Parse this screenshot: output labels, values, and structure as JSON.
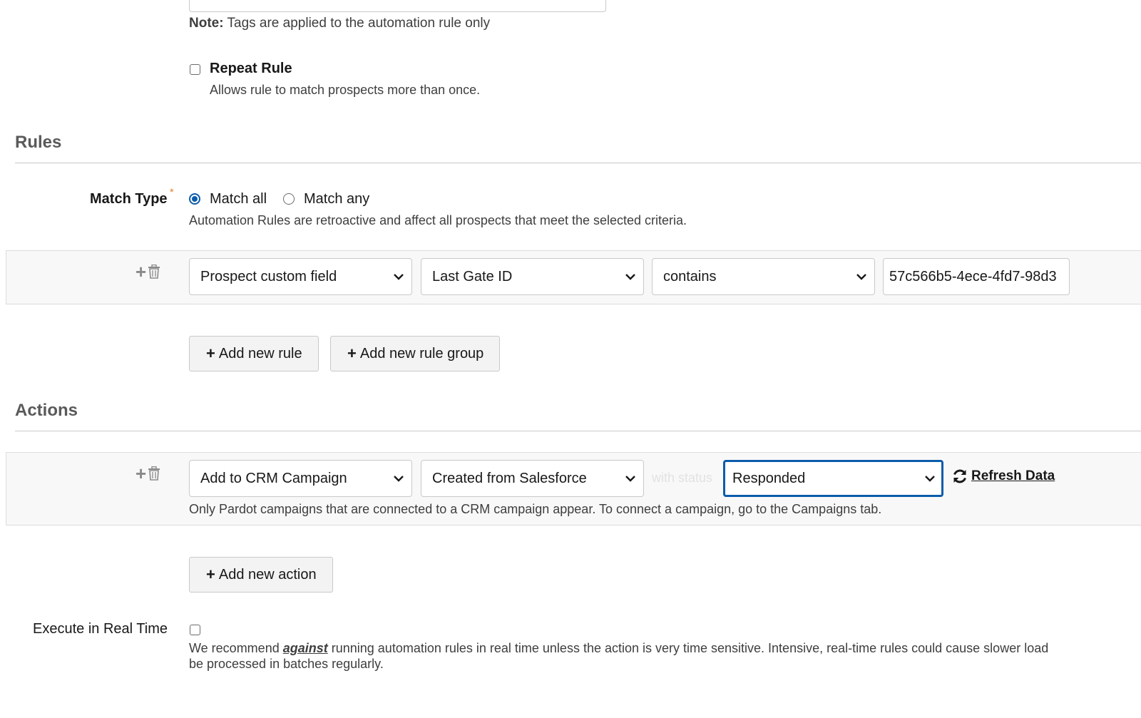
{
  "tags": {
    "note_label": "Note:",
    "note_text": " Tags are applied to the automation rule only"
  },
  "repeat_rule": {
    "label": "Repeat Rule",
    "help": "Allows rule to match prospects more than once.",
    "checked": false
  },
  "rules": {
    "section_title": "Rules",
    "match_type_label": "Match Type",
    "required_mark": "*",
    "match_all_label": "Match all",
    "match_any_label": "Match any",
    "selected_match": "all",
    "help": "Automation Rules are retroactive and affect all prospects that meet the selected criteria.",
    "rule_row": {
      "field_type": "Prospect custom field",
      "field": "Last Gate ID",
      "operator": "contains",
      "value": "57c566b5-4ece-4fd7-98d3"
    },
    "add_rule_label": "Add new rule",
    "add_rule_group_label": "Add new rule group"
  },
  "actions": {
    "section_title": "Actions",
    "action_row": {
      "action_type": "Add to CRM Campaign",
      "campaign": "Created from Salesforce",
      "status_prefix": "with status",
      "status": "Responded",
      "refresh_label": " Refresh Data",
      "help": "Only Pardot campaigns that are connected to a CRM campaign appear. To connect a campaign, go to the Campaigns tab."
    },
    "add_action_label": "Add new action"
  },
  "execute_real_time": {
    "label": "Execute in Real Time",
    "checked": false,
    "help_before": "We recommend ",
    "help_emphasis": "against",
    "help_after": " running automation rules in real time unless the action is very time sensitive. Intensive, real-time rules could cause slower load",
    "help_line2": "be processed in batches regularly."
  },
  "colors": {
    "accent": "#0b5cab",
    "required": "#e07a1f",
    "section_title": "#5a5a5a",
    "panel_bg": "#f8f8f8"
  },
  "icons": [
    "plus-icon",
    "trash-icon",
    "chevron-down-icon",
    "refresh-icon"
  ]
}
